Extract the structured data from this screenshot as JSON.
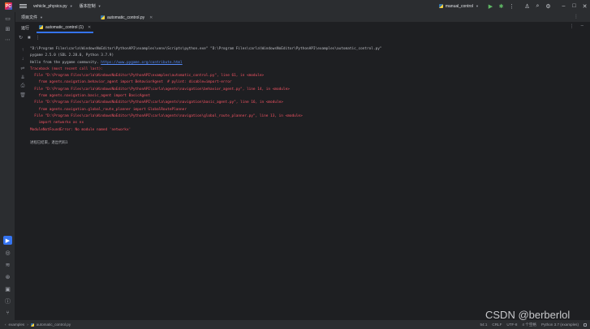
{
  "titlebar": {
    "logo_letters": "PC",
    "project_name": "vehicle_physics.py",
    "vcs_label": "版本控制",
    "run_config": "manual_control",
    "icons": [
      "main-menu-icon",
      "run-icon",
      "debug-icon",
      "more-icon",
      "user-icon",
      "search-icon",
      "settings-icon",
      "minimize-icon",
      "maximize-icon",
      "close-icon"
    ]
  },
  "stripe": {
    "project_files_label": "项目文件",
    "editor_tab": "automatic_control.py"
  },
  "run": {
    "title": "运行",
    "tab_label": "automatic_control (1)"
  },
  "console": {
    "lines": [
      {
        "text": "\"D:\\Program Files\\carla\\WindowsNoEditor\\PythonAPI\\examples\\venv\\Scripts\\python.exe\" \"D:\\Program Files\\carla\\WindowsNoEditor\\PythonAPI\\examples\\automatic_control.py\"",
        "style": "norm"
      },
      {
        "text": "pygame 2.5.0 (SDL 2.28.0, Python 3.7.9)",
        "style": "norm"
      },
      {
        "text": "Hello from the pygame community. ",
        "style": "norm",
        "link": "https://www.pygame.org/contribute.html"
      },
      {
        "text": "Traceback (most recent call last):",
        "style": "err"
      },
      {
        "text": "  File \"D:\\Program Files\\carla\\WindowsNoEditor\\PythonAPI\\examples\\automatic_control.py\", line 61, in <module>",
        "style": "err"
      },
      {
        "text": "    from agents.navigation.behavior_agent import BehaviorAgent  # pylint: disable=import-error",
        "style": "err"
      },
      {
        "text": "  File \"D:\\Program Files\\carla\\WindowsNoEditor\\PythonAPI\\carla\\agents\\navigation\\behavior_agent.py\", line 14, in <module>",
        "style": "err"
      },
      {
        "text": "    from agents.navigation.basic_agent import BasicAgent",
        "style": "err"
      },
      {
        "text": "  File \"D:\\Program Files\\carla\\WindowsNoEditor\\PythonAPI\\carla\\agents\\navigation\\basic_agent.py\", line 16, in <module>",
        "style": "err"
      },
      {
        "text": "    from agents.navigation.global_route_planner import GlobalRoutePlanner",
        "style": "err"
      },
      {
        "text": "  File \"D:\\Program Files\\carla\\WindowsNoEditor\\PythonAPI\\carla\\agents\\navigation\\global_route_planner.py\", line 13, in <module>",
        "style": "err"
      },
      {
        "text": "    import networkx as nx",
        "style": "err"
      },
      {
        "text": "ModuleNotFoundError: No module named 'networkx'",
        "style": "err"
      },
      {
        "text": "",
        "style": "norm"
      },
      {
        "text": "进程已结束，退出代码1",
        "style": "norm"
      }
    ]
  },
  "watermark": "CSDN @berberlol",
  "statusbar": {
    "breadcrumb_root": "examples",
    "breadcrumb_file": "automatic_control.py",
    "position": "54:1",
    "line_sep": "CRLF",
    "encoding": "UTF-8",
    "indent": "4 个空格",
    "interpreter": "Python 3.7 (examples)"
  },
  "colors": {
    "accent": "#3574f0",
    "error": "#f75464",
    "link": "#548af7",
    "run_green": "#5fb865"
  }
}
